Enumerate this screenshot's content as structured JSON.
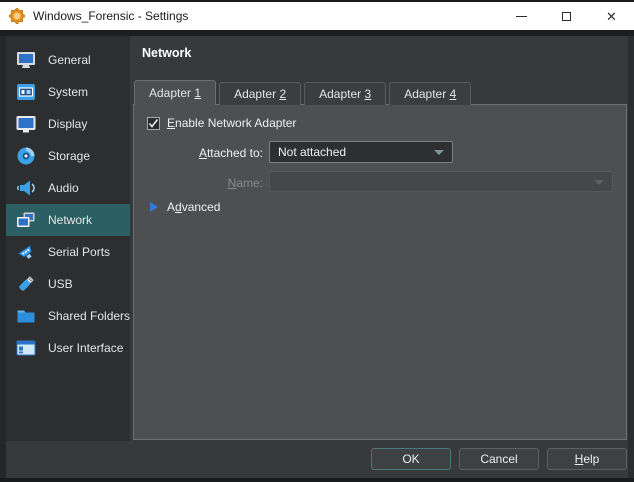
{
  "titlebar": {
    "title": "Windows_Forensic - Settings",
    "app_icon": "virtualbox-settings-gear-icon",
    "controls": {
      "minimize": "minimize-icon",
      "maximize": "maximize-icon",
      "close": "close-icon",
      "close_glyph": "✕"
    }
  },
  "sidebar": {
    "items": [
      {
        "label": "General",
        "icon": "general-monitor-icon",
        "selected": false
      },
      {
        "label": "System",
        "icon": "system-chipset-icon",
        "selected": false
      },
      {
        "label": "Display",
        "icon": "display-monitor-icon",
        "selected": false
      },
      {
        "label": "Storage",
        "icon": "storage-disk-icon",
        "selected": false
      },
      {
        "label": "Audio",
        "icon": "audio-speaker-icon",
        "selected": false
      },
      {
        "label": "Network",
        "icon": "network-adapters-icon",
        "selected": true
      },
      {
        "label": "Serial Ports",
        "icon": "serial-port-icon",
        "selected": false
      },
      {
        "label": "USB",
        "icon": "usb-stick-icon",
        "selected": false
      },
      {
        "label": "Shared Folders",
        "icon": "shared-folder-icon",
        "selected": false
      },
      {
        "label": "User Interface",
        "icon": "user-interface-icon",
        "selected": false
      }
    ]
  },
  "main": {
    "header": "Network",
    "tabs": [
      {
        "pre": "Adapter ",
        "mnemonic": "1",
        "active": true
      },
      {
        "pre": "Adapter ",
        "mnemonic": "2",
        "active": false
      },
      {
        "pre": "Adapter ",
        "mnemonic": "3",
        "active": false
      },
      {
        "pre": "Adapter ",
        "mnemonic": "4",
        "active": false
      }
    ],
    "form": {
      "enable_adapter": {
        "checked": true,
        "mnemonic": "E",
        "post": "nable Network Adapter"
      },
      "attached_to": {
        "mnemonic": "A",
        "post": "ttached to:",
        "value": "Not attached"
      },
      "name": {
        "mnemonic": "N",
        "post": "ame:",
        "value": "",
        "disabled": true
      },
      "advanced": {
        "pre": "A",
        "mnemonic": "d",
        "post": "vanced"
      }
    }
  },
  "footer": {
    "ok": "OK",
    "cancel": "Cancel",
    "help": {
      "mnemonic": "H",
      "post": "elp"
    }
  },
  "colors": {
    "titlebar_bg": "#ffffff",
    "window_bg": "#37393b",
    "sidebar_bg": "#2c2e30",
    "sidebar_selected": "#2b5f63",
    "panel_bg": "#4d4f51",
    "icon_blue": "#2e7cd0",
    "title_icon_orange": "#f0a030",
    "combo_arrow_teal": "#7e9698",
    "advanced_arrow_blue": "#2f7cd8",
    "ok_button_border": "#4b797d"
  }
}
